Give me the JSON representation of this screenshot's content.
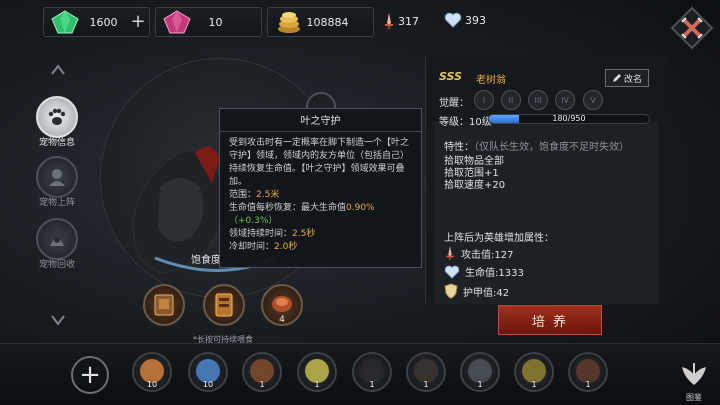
{
  "currencies": [
    {
      "name": "emerald",
      "value": "1600"
    },
    {
      "name": "ruby",
      "value": "10"
    },
    {
      "name": "gold",
      "value": "108884"
    }
  ],
  "stats": {
    "attack_value": "317",
    "life_value": "393"
  },
  "nav": [
    {
      "label": "宠物信息",
      "active": true
    },
    {
      "label": "宠物上阵",
      "active": false
    },
    {
      "label": "宠物回收",
      "active": false
    }
  ],
  "pet": {
    "name": "老树翁",
    "rarity": "SSS",
    "hunger_label_partial": "饱食度",
    "awaken_label": "觉醒：",
    "awaken_levels": [
      "I",
      "II",
      "III",
      "IV",
      "V"
    ],
    "level_label": "等级：10级",
    "exp_current": 180,
    "exp_max": 950,
    "exp_text": "180/950",
    "rename_label": "改名",
    "traits_title": "特性：",
    "traits_note": "（仅队长生效，饱食度不足时失效）",
    "traits": [
      "拾取物品全部",
      "拾取范围+1",
      "拾取速度+20"
    ],
    "bonus_title": "上阵后为英雄增加属性：",
    "bonus": [
      {
        "icon": "sword-icon",
        "text": "攻击值:127"
      },
      {
        "icon": "heart-icon",
        "text": "生命值:1333"
      },
      {
        "icon": "shield-icon",
        "text": "护甲值:42"
      }
    ],
    "cultivate_label": "培 养"
  },
  "tooltip": {
    "title": "叶之守护",
    "desc": "受到攻击时有一定概率在脚下制造一个【叶之守护】领域，领域内的友方单位（包括自己）持续恢复生命值。【叶之守护】领域效果可叠加。",
    "range_label": "范围：",
    "range_value": "2.5米",
    "regen_label": "生命值每秒恢复：最大生命值",
    "regen_value": "0.90%",
    "regen_bonus": "（+0.3%）",
    "duration_label": "领域持续时间：",
    "duration_value": "2.5秒",
    "cooldown_label": "冷却时间：",
    "cooldown_value": "2.0秒"
  },
  "skills": [
    {
      "num": ""
    },
    {
      "num": ""
    },
    {
      "num": "4"
    }
  ],
  "skills_hint": "*长按可持续喂食",
  "roster": [
    {
      "lv": "10",
      "color": "#c77a3a"
    },
    {
      "lv": "10",
      "color": "#4a7fc2"
    },
    {
      "lv": "1",
      "color": "#7a4a2a"
    },
    {
      "lv": "1",
      "color": "#b9b34a"
    },
    {
      "lv": "1",
      "color": "#2a2a2e"
    },
    {
      "lv": "1",
      "color": "#3a3430"
    },
    {
      "lv": "1",
      "color": "#4a5058"
    },
    {
      "lv": "1",
      "color": "#8a7a30"
    },
    {
      "lv": "1",
      "color": "#5a3a2a"
    }
  ],
  "handbook_label": "图鉴",
  "colors": {
    "accent_gold": "#e6a84a",
    "accent_green": "#6fbf52",
    "exp_blue": "#3b86e8",
    "cultivate_red": "#8a2416"
  }
}
